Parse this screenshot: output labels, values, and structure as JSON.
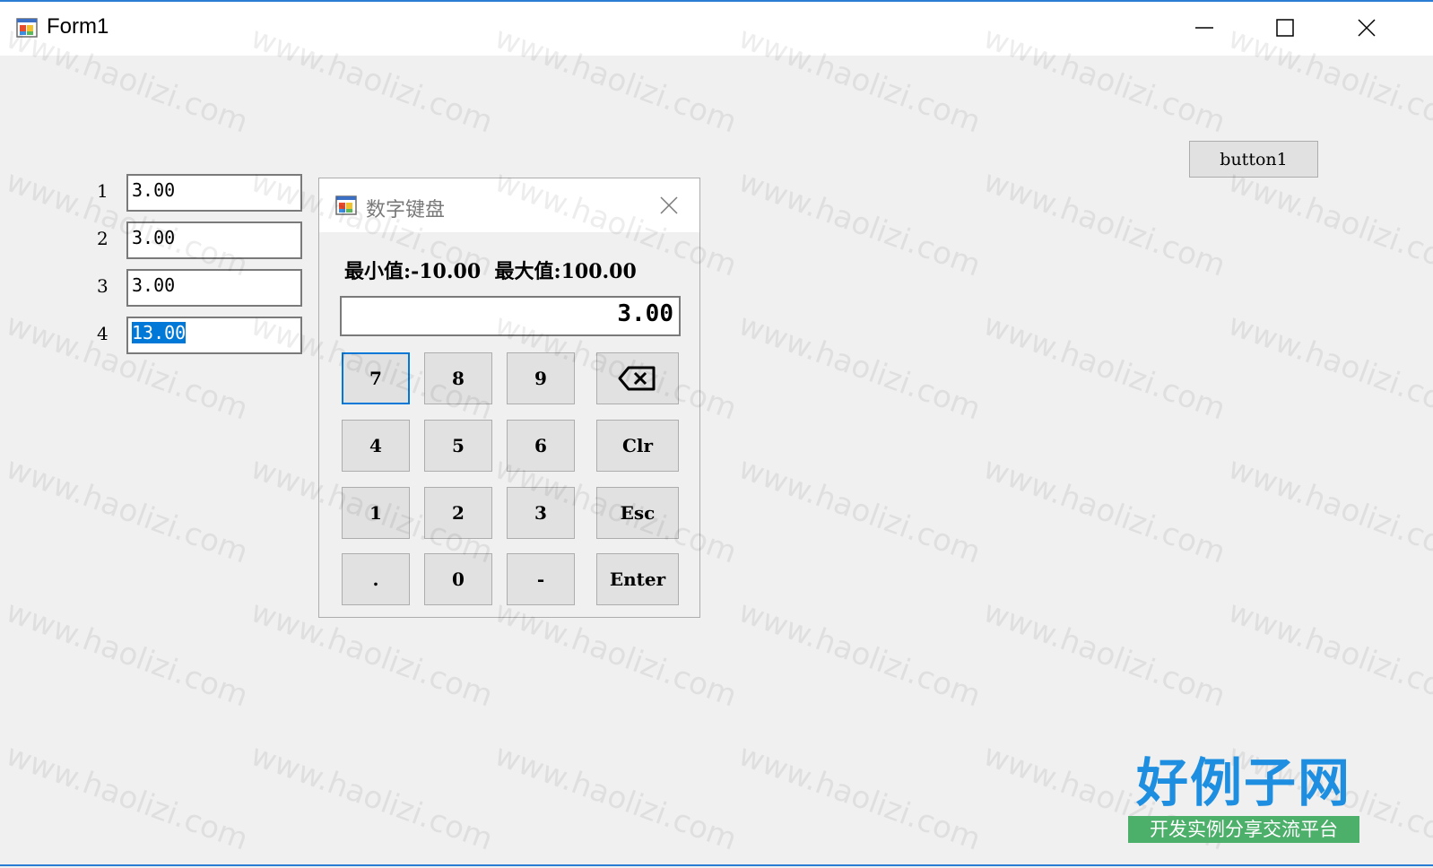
{
  "window": {
    "title": "Form1",
    "icon": "app-form-icon",
    "controls": {
      "minimize": "minimize-icon",
      "maximize": "maximize-icon",
      "close": "close-icon"
    }
  },
  "inputs": [
    {
      "label": "1",
      "value": "3.00"
    },
    {
      "label": "2",
      "value": "3.00"
    },
    {
      "label": "3",
      "value": "3.00"
    },
    {
      "label": "4",
      "value": "13.00"
    }
  ],
  "button1": {
    "label": "button1"
  },
  "keypad": {
    "title": "数字键盘",
    "range_text": "最小值:-10.00  最大值:100.00",
    "display_value": "3.00",
    "keys": {
      "k7": "7",
      "k8": "8",
      "k9": "9",
      "k4": "4",
      "k5": "5",
      "k6": "6",
      "k1": "1",
      "k2": "2",
      "k3": "3",
      "kdot": ".",
      "k0": "0",
      "kminus": "-",
      "backspace": "backspace-icon",
      "clr": "Clr",
      "esc": "Esc",
      "enter": "Enter"
    }
  },
  "watermark": {
    "text": "www.haolizi.com"
  },
  "logo": {
    "main": "好例子网",
    "sub": "开发实例分享交流平台"
  },
  "colors": {
    "accent": "#0078d7",
    "window_border": "#2b7cd3",
    "logo_blue": "#1e8fe0",
    "logo_green": "#4caf6a"
  }
}
